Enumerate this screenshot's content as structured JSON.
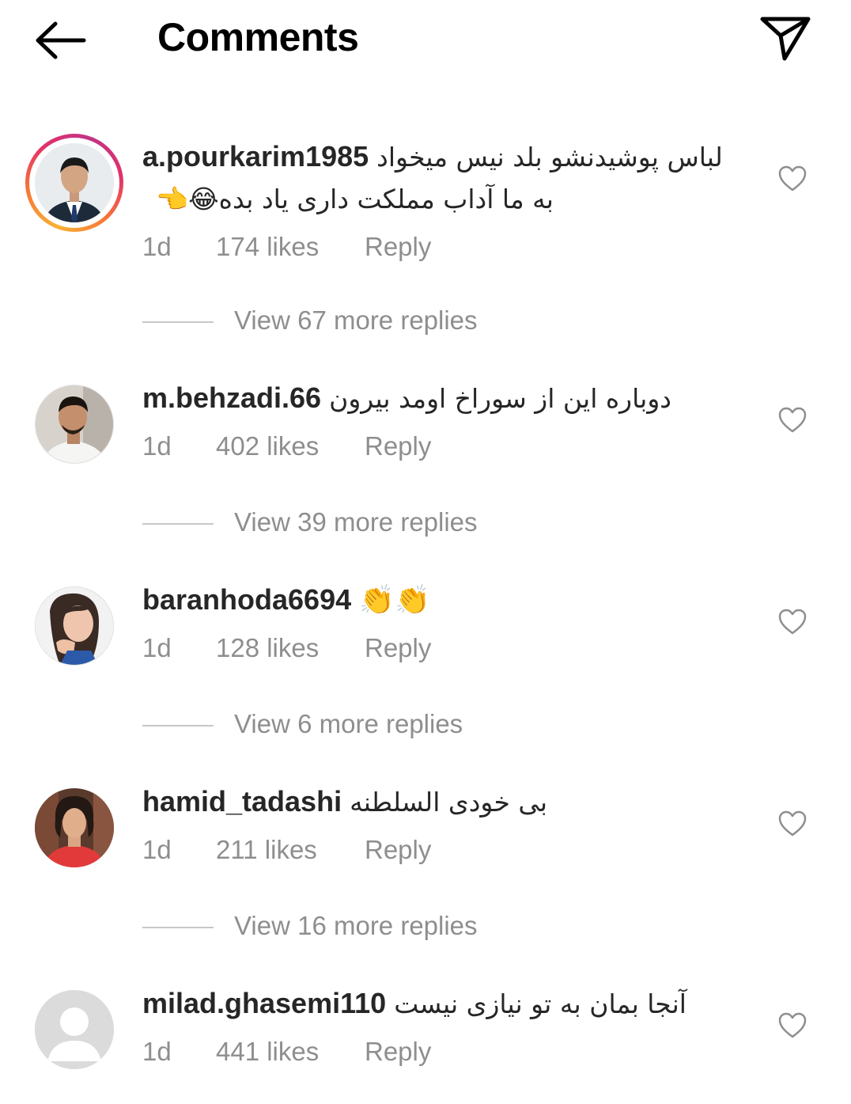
{
  "header": {
    "title": "Comments",
    "back_icon": "arrow-left-icon",
    "send_icon": "paper-plane-icon"
  },
  "colors": {
    "text": "#262626",
    "secondary": "#8e8e8e",
    "story_ring": [
      "#f9b233",
      "#e1306c",
      "#c13584"
    ]
  },
  "comments": [
    {
      "username": "a.pourkarim1985",
      "text_line1": "لباس پوشیدنشو بلد نیس میخواد",
      "text_line2": "به ما آداب مملکت داری یاد بده😂👈",
      "time": "1d",
      "likes": "174 likes",
      "reply": "Reply",
      "replies": "View 67 more replies",
      "has_story": true
    },
    {
      "username": "m.behzadi.66",
      "text_line1": "دوباره این از سوراخ اومد بیرون",
      "time": "1d",
      "likes": "402 likes",
      "reply": "Reply",
      "replies": "View 39 more replies"
    },
    {
      "username": "baranhoda6694",
      "text_line1": "👏👏",
      "time": "1d",
      "likes": "128 likes",
      "reply": "Reply",
      "replies": "View 6 more replies"
    },
    {
      "username": "hamid_tadashi",
      "text_line1": "بی خودی السلطنه",
      "time": "1d",
      "likes": "211 likes",
      "reply": "Reply",
      "replies": "View 16 more replies"
    },
    {
      "username": "milad.ghasemi110",
      "text_line1": "آنجا بمان به تو نیازی نیست",
      "time": "1d",
      "likes": "441 likes",
      "reply": "Reply"
    }
  ]
}
